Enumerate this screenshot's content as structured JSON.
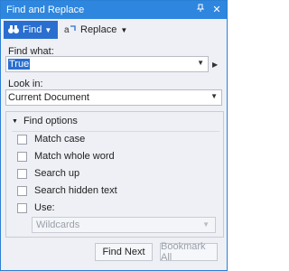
{
  "window": {
    "title": "Find and Replace",
    "accent": "#2e86de"
  },
  "toolbar": {
    "find_label": "Find",
    "replace_label": "Replace"
  },
  "find_what": {
    "label": "Find what:",
    "value": "True"
  },
  "look_in": {
    "label": "Look in:",
    "value": "Current Document"
  },
  "find_options": {
    "header": "Find options",
    "items": [
      {
        "label": "Match case",
        "checked": false
      },
      {
        "label": "Match whole word",
        "checked": false
      },
      {
        "label": "Search up",
        "checked": false
      },
      {
        "label": "Search hidden text",
        "checked": false
      },
      {
        "label": "Use:",
        "checked": false
      }
    ],
    "use_value": "Wildcards"
  },
  "buttons": {
    "find_next": "Find Next",
    "bookmark_all": "Bookmark All"
  }
}
